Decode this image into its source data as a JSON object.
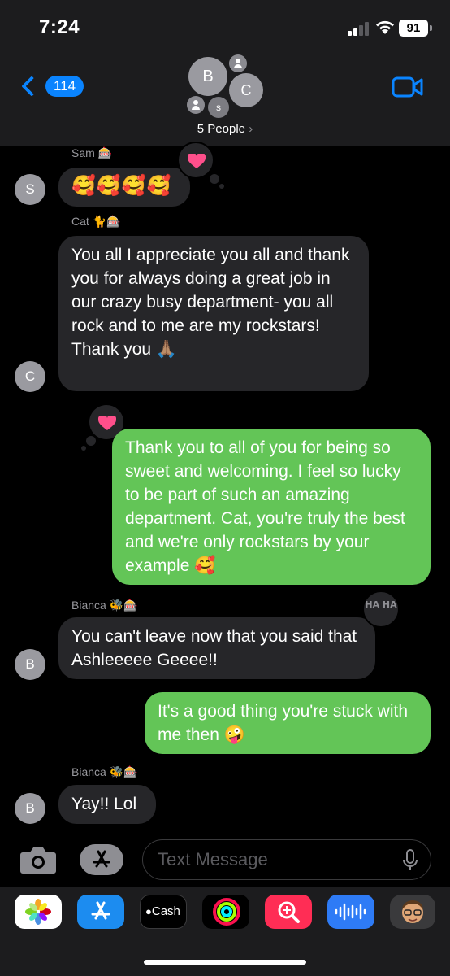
{
  "status_bar": {
    "time": "7:24",
    "battery": "91"
  },
  "header": {
    "back_count": "114",
    "avatars": {
      "b": "B",
      "c": "C",
      "s": "s"
    },
    "group_name": "5 People",
    "chevron": "›"
  },
  "messages": [
    {
      "sender": "Sam 🎰",
      "avatar": "S",
      "text": "🥰🥰🥰🥰",
      "direction": "incoming",
      "tapback": "heart"
    },
    {
      "sender": "Cat 🐈🎰",
      "avatar": "C",
      "text": "You all I appreciate you all and thank you for always doing a great job in our crazy busy department- you all rock and to me are my rockstars! Thank you 🙏🏽",
      "direction": "incoming"
    },
    {
      "text": "Thank you to all of you for being so sweet and welcoming. I feel so lucky to be part of such an amazing department. Cat, you're truly the best and we're only rockstars by your example 🥰",
      "direction": "outgoing",
      "tapback": "heart"
    },
    {
      "sender": "Bianca 🐝🎰",
      "avatar": "B",
      "text": "You can't leave now that you said that  Ashleeeee Geeee!!",
      "direction": "incoming",
      "tapback": "haha",
      "tapback_text": "HA HA"
    },
    {
      "text": "It's a good thing you're stuck with me then 🤪",
      "direction": "outgoing"
    },
    {
      "sender": "Bianca 🐝🎰",
      "avatar": "B",
      "text": "Yay!! Lol",
      "direction": "incoming"
    }
  ],
  "input": {
    "placeholder": "Text Message"
  },
  "app_drawer": [
    {
      "name": "Photos",
      "icon": "photos-icon"
    },
    {
      "name": "App Store",
      "icon": "app-store-icon"
    },
    {
      "name": "Cash",
      "label": "Cash",
      "icon": "apple-cash-icon"
    },
    {
      "name": "Fitness",
      "icon": "activity-rings-icon"
    },
    {
      "name": "Search Images",
      "icon": "image-search-icon"
    },
    {
      "name": "Audio",
      "icon": "audio-waveform-icon"
    },
    {
      "name": "Memoji",
      "icon": "memoji-icon"
    }
  ],
  "colors": {
    "accent": "#0a84ff",
    "outgoing_bubble": "#63c557",
    "incoming_bubble": "#262629",
    "heart": "#ff4f8b"
  }
}
